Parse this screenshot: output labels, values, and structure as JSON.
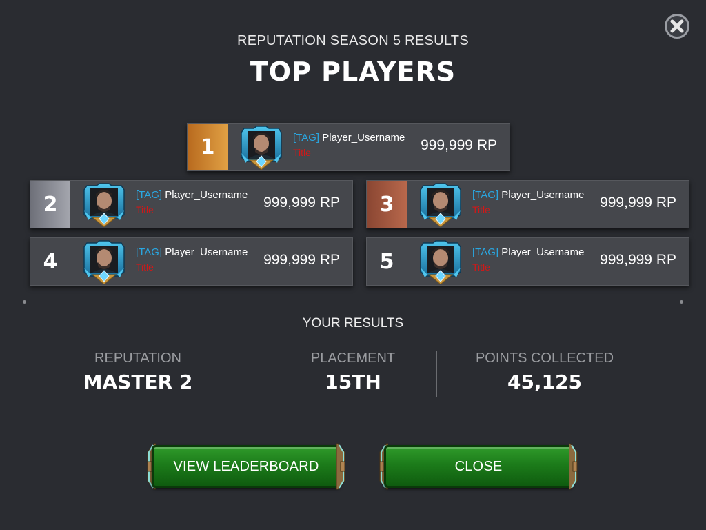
{
  "header": {
    "subtitle": "REPUTATION SEASON 5 RESULTS",
    "title": "TOP PLAYERS"
  },
  "rank_colors": {
    "1": "#d08a2e",
    "2": "#8e9099",
    "3": "#a85a40",
    "4": "#45474c",
    "5": "#45474c"
  },
  "players": [
    {
      "rank": "1",
      "tag": "[TAG]",
      "username": "Player_Username",
      "title": "Title",
      "points": "999,999 RP"
    },
    {
      "rank": "2",
      "tag": "[TAG]",
      "username": "Player_Username",
      "title": "Title",
      "points": "999,999 RP"
    },
    {
      "rank": "3",
      "tag": "[TAG]",
      "username": "Player_Username",
      "title": "Title",
      "points": "999,999 RP"
    },
    {
      "rank": "4",
      "tag": "[TAG]",
      "username": "Player_Username",
      "title": "Title",
      "points": "999,999 RP"
    },
    {
      "rank": "5",
      "tag": "[TAG]",
      "username": "Player_Username",
      "title": "Title",
      "points": "999,999 RP"
    }
  ],
  "your_results": {
    "heading": "YOUR RESULTS",
    "stats": [
      {
        "label": "REPUTATION",
        "value": "MASTER 2"
      },
      {
        "label": "PLACEMENT",
        "value": "15TH"
      },
      {
        "label": "POINTS COLLECTED",
        "value": "45,125"
      }
    ]
  },
  "buttons": {
    "view_leaderboard": "VIEW LEADERBOARD",
    "close": "CLOSE"
  },
  "icons": {
    "close": "close-icon",
    "avatar": "player-avatar-icon"
  }
}
